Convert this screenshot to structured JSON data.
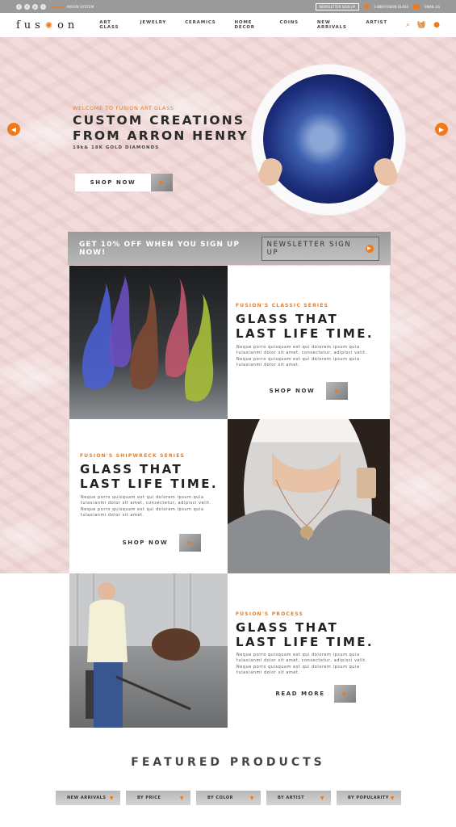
{
  "topbar": {
    "social": [
      "f",
      "t",
      "p",
      "i"
    ],
    "tagline_pre": "",
    "tagline": "ARRON SYSTEM",
    "newsletter_btn": "NEWSLETTER SIGN UP",
    "phone": "1-888-FUSION-GLASS",
    "email": "EMAIL US"
  },
  "nav": {
    "logo_pre": "fus",
    "logo_post": "on",
    "items": [
      "ART GLASS",
      "JEWELRY",
      "CERAMICS",
      "HOME DECOR",
      "COINS",
      "NEW ARRIVALS",
      "ARTIST"
    ]
  },
  "hero": {
    "kicker": "WELCOME TO FUSION ART GLASS",
    "title_line1": "CUSTOM CREATIONS",
    "title_line2": "FROM ARRON HENRY",
    "subtitle": "19k& 18K GOLD DIAMONDS",
    "button": "SHOP NOW"
  },
  "signup": {
    "text": "GET 10% OFF WHEN YOU SIGN UP NOW!",
    "button": "NEWSLETTER SIGN UP"
  },
  "sections": [
    {
      "kicker": "FUSION'S CLASSIC SERIES",
      "title1": "GLASS THAT",
      "title2": "LAST LIFE TIME.",
      "body": "Neque porro quisquam est qui dolorem ipsum quia tulaxianmi dolor sit amet, consectetur, adipisci velit. Neque porro quisquam est qui dolorem ipsum quia tulaxianmi dolor sit amet.",
      "button": "SHOP NOW"
    },
    {
      "kicker": "FUSION'S SHIPWRECK SERIES",
      "title1": "GLASS THAT",
      "title2": "LAST LIFE TIME.",
      "body": "Neque porro quisquam est qui dolorem ipsum quia tulaxianmi dolor sit amet, consectetur, adipisci velit. Neque porro quisquam est qui dolorem ipsum quia tulaxianmi dolor sit amet.",
      "button": "SHOP NOW"
    },
    {
      "kicker": "FUSION'S PROCESS",
      "title1": "GLASS THAT",
      "title2": "LAST LIFE TIME.",
      "body": "Neque porro quisquam est qui dolorem ipsum quia tulaxianmi dolor sit amet, consectetur, adipisci velit. Neque porro quisquam est qui dolorem ipsum quia tulaxianmi dolor sit amet.",
      "button": "READ MORE"
    }
  ],
  "featured": {
    "title": "FEATURED PRODUCTS",
    "filters": [
      "NEW ARRIVALS",
      "BY PRICE",
      "BY COLOR",
      "BY ARTIST",
      "BY POPULARITY"
    ]
  },
  "colors": {
    "accent": "#f07a1a",
    "pink_bg": "#f1dcdb",
    "gray_btn": "#9b9b9b"
  },
  "icons": {
    "search": "search-icon",
    "cart": "cart-icon",
    "account": "account-icon"
  }
}
